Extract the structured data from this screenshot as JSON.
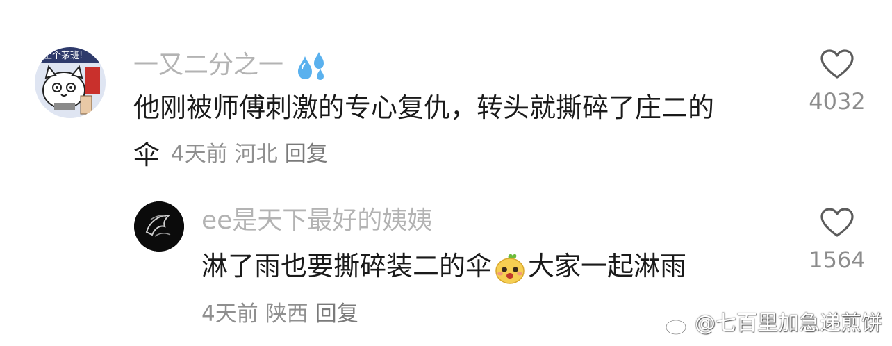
{
  "comments": [
    {
      "username": "一又二分之一",
      "username_emoji": "sweat-droplets-icon",
      "text_line1": "他刚被师傅刺激的专心复仇，转头就撕碎了庄二的",
      "text_line2": "伞",
      "time": "4天前",
      "location": "河北",
      "reply_label": "回复",
      "likes": "4032",
      "avatar_text": "上个茅班!"
    },
    {
      "username": "ee是天下最好的姨姨",
      "text_before_emoji": "淋了雨也要撕碎装二的伞",
      "text_emoji": "smiling-face-sticker-icon",
      "text_after_emoji": "大家一起淋雨",
      "time": "4天前",
      "location": "陕西",
      "reply_label": "回复",
      "likes": "1564"
    }
  ],
  "watermark": {
    "text": "@七百里加急递煎饼",
    "icon": "weibo-icon"
  },
  "colors": {
    "username": "#b3b3b3",
    "content": "#1a1a1a",
    "meta": "#8f8f8f"
  }
}
